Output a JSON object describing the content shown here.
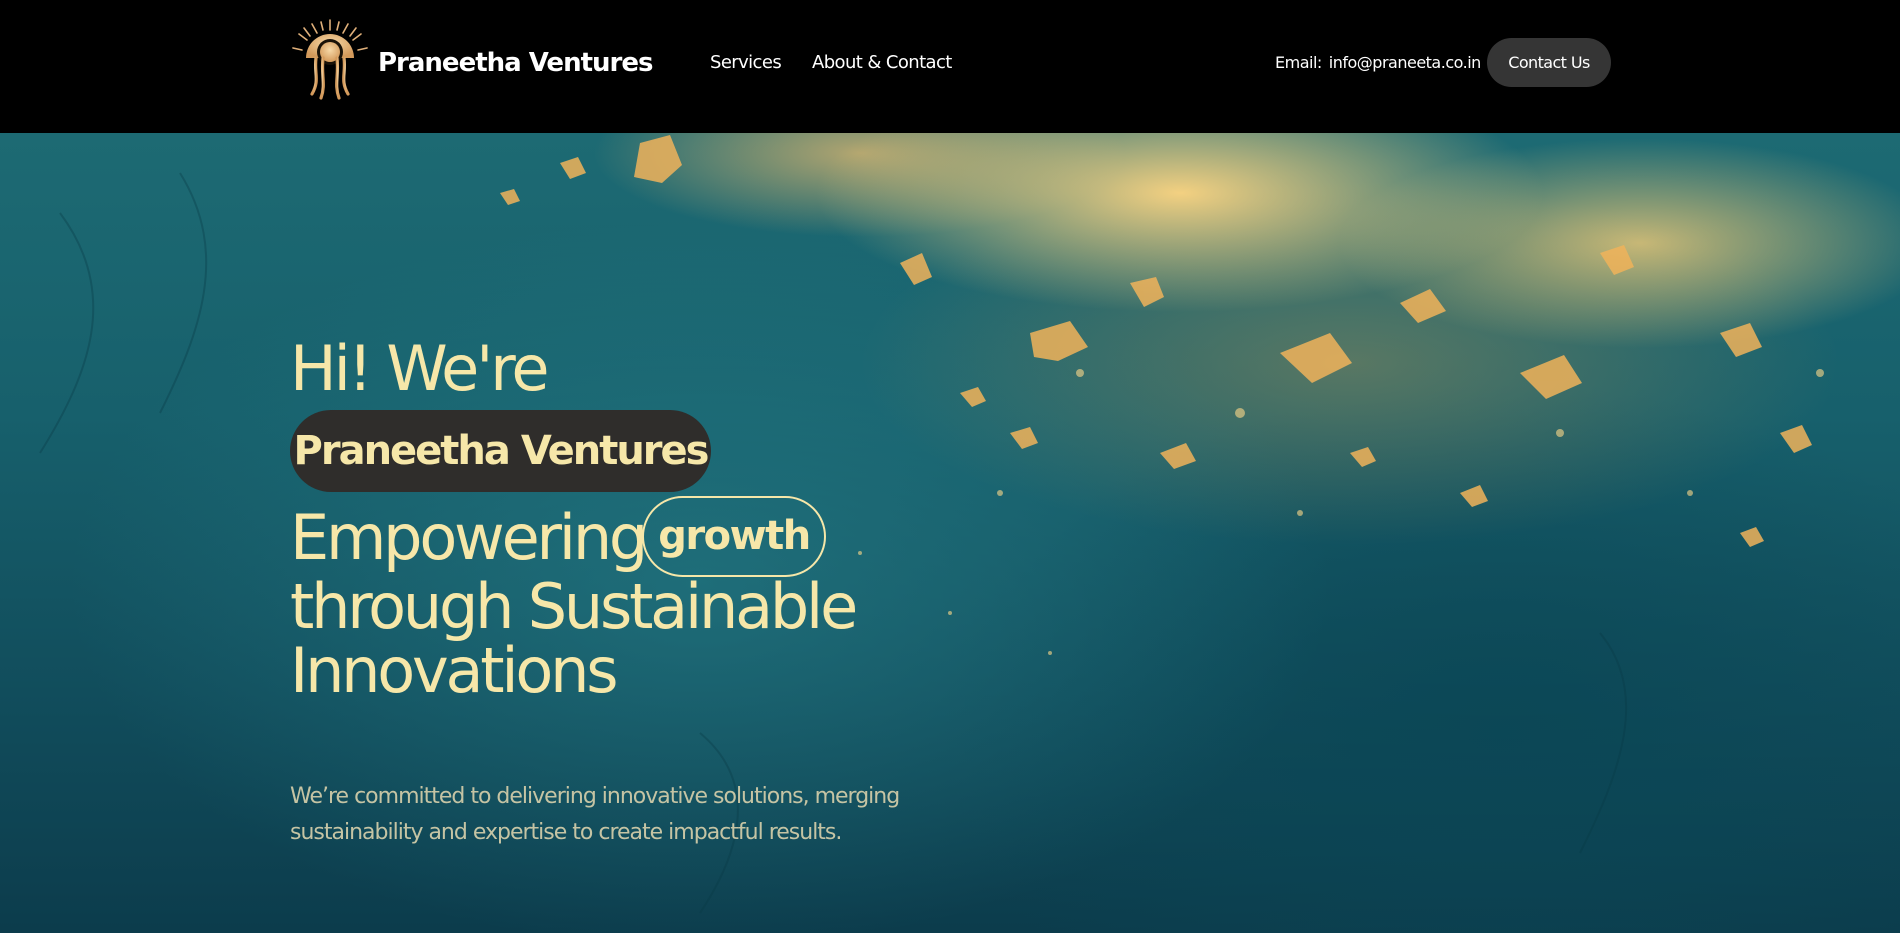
{
  "header": {
    "brand_name": "Praneetha Ventures",
    "logo_icon": "sun-jellyfish-logo",
    "nav": {
      "services": "Services",
      "about_contact": "About & Contact"
    },
    "email_label": "Email:",
    "email_value": "info@praneeta.co.in",
    "contact_button": "Contact Us"
  },
  "hero": {
    "greeting": "Hi! We're",
    "name_pill": "Praneetha Ventures",
    "headline_word1": "Empowering",
    "growth_pill": "growth",
    "headline_line2": "through Sustainable",
    "headline_line3": "Innovations",
    "description": "We’re committed to delivering innovative solutions, merging sustainability and expertise to create impactful results."
  },
  "colors": {
    "header_bg": "#000000",
    "accent_cream": "#f6e7a9",
    "pill_dark": "#2f2d2b",
    "button_bg": "#353535",
    "hero_teal": "#17606c",
    "hero_gold": "#ffd682"
  }
}
